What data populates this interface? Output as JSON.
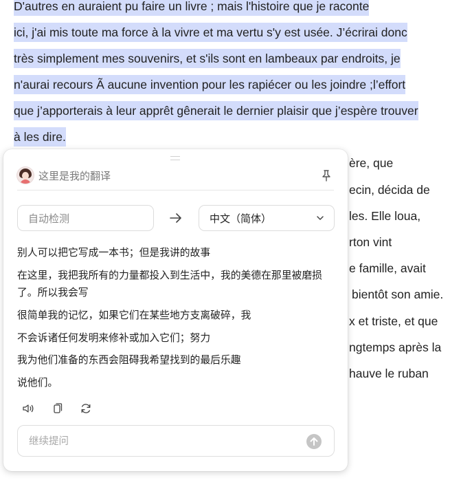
{
  "document": {
    "lines": [
      "D'autres en auraient pu faire un livre ; mais l'histoire que je raconte",
      "ici, j'ai mis toute ma force à la vivre et ma vertu s'y est usée. J’écrirai donc",
      "très simplement mes souvenirs, et s'ils sont en lambeaux par endroits, je",
      "n'aurai recours Ã aucune invention pour les rapiécer ou les joindre ;l’effort",
      "que j’apporterais à leur apprêt gênerait le dernier plaisir que j’espère trouver",
      "à les dire.",
      "ère, que",
      "ecin, décida de",
      "les. Elle loua,",
      "rton vint",
      "e famille, avait",
      "bientôt son amie.",
      "x et triste, et que",
      "ngtemps après la",
      "hauve le ruban"
    ]
  },
  "popup": {
    "title": "这里是我的翻译",
    "source_lang": "自动检测",
    "target_lang": "中文（简体）",
    "translation": [
      "别人可以把它写成一本书；但是我讲的故事",
      "在这里，我把我所有的力量都投入到生活中，我的美德在那里被磨损了。所以我会写",
      "很简单我的记忆，如果它们在某些地方支离破碎，我",
      "不会诉诸任何发明来修补或加入它们；努力",
      "我为他们准备的东西会阻碍我希望找到的最后乐趣",
      "说他们。"
    ],
    "followup_placeholder": "继续提问",
    "icons": {
      "avatar": "avatar-icon",
      "pin": "pin-icon",
      "arrow": "arrow-right-icon",
      "chevron": "chevron-down-icon",
      "speak": "speaker-icon",
      "copy": "copy-icon",
      "refresh": "refresh-icon",
      "send": "send-up-arrow-icon"
    }
  },
  "colors": {
    "selection": "#d3dcfb",
    "send_disabled": "#c5c5c5"
  }
}
